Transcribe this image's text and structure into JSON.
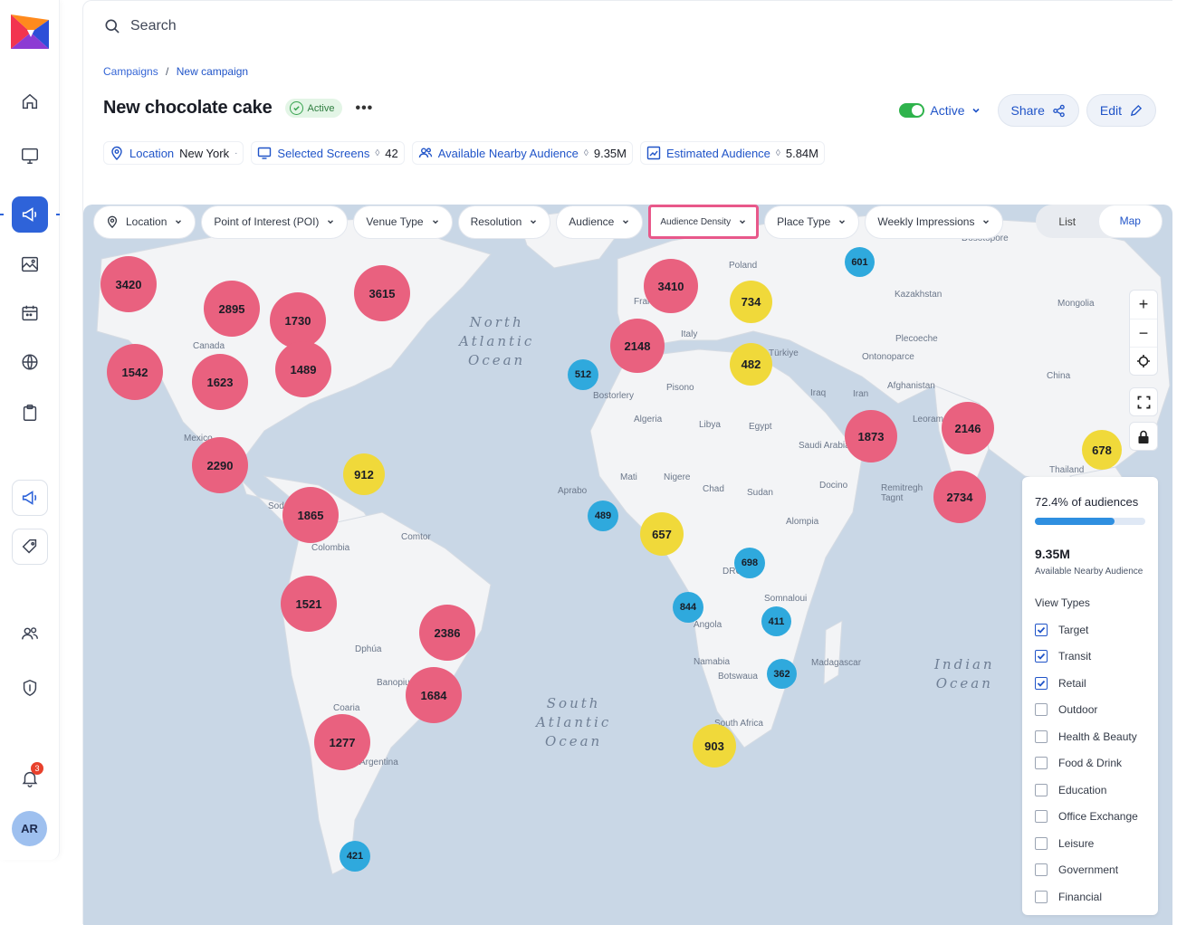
{
  "search": {
    "placeholder": "Search"
  },
  "breadcrumb": {
    "parent": "Campaigns",
    "separator": "/",
    "current": "New campaign"
  },
  "campaign": {
    "title": "New chocolate cake",
    "status": "Active",
    "more": "•••"
  },
  "actions": {
    "toggle_label": "Active",
    "share": "Share",
    "edit": "Edit"
  },
  "meta": {
    "location_label": "Location",
    "location_value": "New York",
    "screens_label": "Selected Screens",
    "screens_value": "42",
    "nearby_label": "Available Nearby Audience",
    "nearby_value": "9.35M",
    "estimated_label": "Estimated Audience",
    "estimated_value": "5.84M"
  },
  "filters": [
    "Location",
    "Point of Interest (POI)",
    "Venue Type",
    "Resolution",
    "Audience",
    "Audience Density",
    "Place Type",
    "Weekly Impressions"
  ],
  "view_toggle": {
    "list": "List",
    "map": "Map",
    "selected": "Map"
  },
  "oceans": {
    "north_atlantic": [
      "North",
      "Atlantic",
      "Ocean"
    ],
    "south_atlantic": [
      "South",
      "Atlantic",
      "Ocean"
    ],
    "indian": [
      "Indian",
      "Ocean"
    ]
  },
  "places": [
    "Canada",
    "Mexico",
    "Colombia",
    "Dphúa",
    "Banopiu",
    "Coaria",
    "Argentina",
    "Comtor",
    "Sod",
    "Poland",
    "Kazakhstan",
    "Mongolia",
    "China",
    "France",
    "Italy",
    "Pisono",
    "Bostorlery",
    "Algeria",
    "Libya",
    "Egypt",
    "Türkiye",
    "Ontonoparce",
    "Iraq",
    "Iran",
    "Afghanistan",
    "Saudi Arabia",
    "Leoram",
    "Docino",
    "Remitregh Tagnt",
    "Mati",
    "Nigere",
    "Chad",
    "Sudan",
    "Alompia",
    "Aprabo",
    "DRC",
    "Somnaloui",
    "Angola",
    "Namabia",
    "Botswaua",
    "South Africa",
    "Madagascar",
    "Thailand",
    "Dosotopore",
    "Plecoeche"
  ],
  "clusters": [
    {
      "value": "3420",
      "color": "red"
    },
    {
      "value": "2895",
      "color": "red"
    },
    {
      "value": "1730",
      "color": "red"
    },
    {
      "value": "3615",
      "color": "red"
    },
    {
      "value": "1542",
      "color": "red"
    },
    {
      "value": "1623",
      "color": "red"
    },
    {
      "value": "1489",
      "color": "red"
    },
    {
      "value": "2290",
      "color": "red"
    },
    {
      "value": "912",
      "color": "yellow"
    },
    {
      "value": "1865",
      "color": "red"
    },
    {
      "value": "1521",
      "color": "red"
    },
    {
      "value": "2386",
      "color": "red"
    },
    {
      "value": "1684",
      "color": "red"
    },
    {
      "value": "1277",
      "color": "red"
    },
    {
      "value": "421",
      "color": "blue"
    },
    {
      "value": "512",
      "color": "blue"
    },
    {
      "value": "2148",
      "color": "red"
    },
    {
      "value": "3410",
      "color": "red"
    },
    {
      "value": "734",
      "color": "yellow"
    },
    {
      "value": "601",
      "color": "blue"
    },
    {
      "value": "482",
      "color": "yellow"
    },
    {
      "value": "489",
      "color": "blue"
    },
    {
      "value": "657",
      "color": "yellow"
    },
    {
      "value": "698",
      "color": "blue"
    },
    {
      "value": "844",
      "color": "blue"
    },
    {
      "value": "411",
      "color": "blue"
    },
    {
      "value": "362",
      "color": "blue"
    },
    {
      "value": "903",
      "color": "yellow"
    },
    {
      "value": "1873",
      "color": "red"
    },
    {
      "value": "2146",
      "color": "red"
    },
    {
      "value": "2734",
      "color": "red"
    },
    {
      "value": "678",
      "color": "yellow"
    }
  ],
  "colors": {
    "red": "#e9617f",
    "yellow": "#f0d93a",
    "blue": "#2fa9dd",
    "accent": "#2054c8"
  },
  "panel": {
    "pct_label": "72.4% of audiences",
    "pct_value": 0.724,
    "big_value": "9.35M",
    "big_sub": "Available Nearby Audience",
    "view_types_head": "View Types",
    "view_types": [
      {
        "label": "Target",
        "checked": true
      },
      {
        "label": "Transit",
        "checked": true
      },
      {
        "label": "Retail",
        "checked": true
      },
      {
        "label": "Outdoor",
        "checked": false
      },
      {
        "label": "Health & Beauty",
        "checked": false
      },
      {
        "label": "Food & Drink",
        "checked": false
      },
      {
        "label": "Education",
        "checked": false
      },
      {
        "label": "Office Exchange",
        "checked": false
      },
      {
        "label": "Leisure",
        "checked": false
      },
      {
        "label": "Government",
        "checked": false
      },
      {
        "label": "Financial",
        "checked": false
      }
    ]
  },
  "sidebar": {
    "avatar": "AR",
    "notification_count": "3"
  },
  "map_controls": [
    "+",
    "−"
  ]
}
